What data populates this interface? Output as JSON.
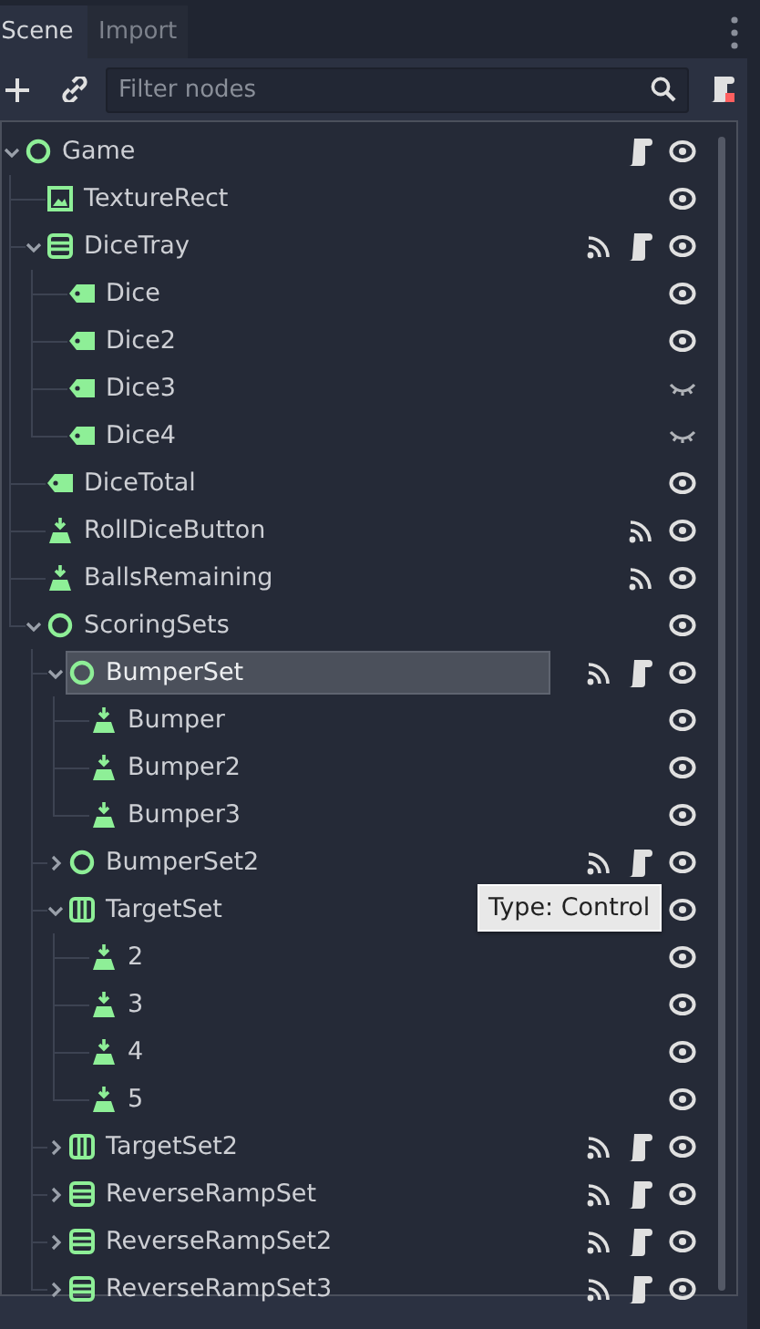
{
  "tabs": [
    {
      "label": "Scene",
      "selected": true
    },
    {
      "label": "Import",
      "selected": false
    }
  ],
  "filter": {
    "placeholder": "Filter nodes"
  },
  "tree": [
    {
      "name": "Game",
      "kind": "control",
      "expanded": true,
      "signals": false,
      "script": true,
      "visible": true,
      "selected": false,
      "children": [
        {
          "name": "TextureRect",
          "kind": "texture_rect",
          "signals": false,
          "script": false,
          "visible": true,
          "selected": false
        },
        {
          "name": "DiceTray",
          "kind": "vbox",
          "expanded": true,
          "signals": true,
          "script": true,
          "visible": true,
          "selected": false,
          "children": [
            {
              "name": "Dice",
              "kind": "label",
              "signals": false,
              "script": false,
              "visible": true,
              "selected": false
            },
            {
              "name": "Dice2",
              "kind": "label",
              "signals": false,
              "script": false,
              "visible": true,
              "selected": false
            },
            {
              "name": "Dice3",
              "kind": "label",
              "signals": false,
              "script": false,
              "visible": false,
              "selected": false
            },
            {
              "name": "Dice4",
              "kind": "label",
              "signals": false,
              "script": false,
              "visible": false,
              "selected": false
            }
          ]
        },
        {
          "name": "DiceTotal",
          "kind": "label",
          "signals": false,
          "script": false,
          "visible": true,
          "selected": false
        },
        {
          "name": "RollDiceButton",
          "kind": "texture_button",
          "signals": true,
          "script": false,
          "visible": true,
          "selected": false
        },
        {
          "name": "BallsRemaining",
          "kind": "texture_button",
          "signals": true,
          "script": false,
          "visible": true,
          "selected": false
        },
        {
          "name": "ScoringSets",
          "kind": "control",
          "expanded": true,
          "signals": false,
          "script": false,
          "visible": true,
          "selected": false,
          "children": [
            {
              "name": "BumperSet",
              "kind": "control",
              "expanded": true,
              "signals": true,
              "script": true,
              "visible": true,
              "selected": true,
              "children": [
                {
                  "name": "Bumper",
                  "kind": "texture_button",
                  "signals": false,
                  "script": false,
                  "visible": true,
                  "selected": false
                },
                {
                  "name": "Bumper2",
                  "kind": "texture_button",
                  "signals": false,
                  "script": false,
                  "visible": true,
                  "selected": false
                },
                {
                  "name": "Bumper3",
                  "kind": "texture_button",
                  "signals": false,
                  "script": false,
                  "visible": true,
                  "selected": false
                }
              ]
            },
            {
              "name": "BumperSet2",
              "kind": "control",
              "expanded": false,
              "signals": true,
              "script": true,
              "visible": true,
              "selected": false
            },
            {
              "name": "TargetSet",
              "kind": "hbox",
              "expanded": true,
              "signals": false,
              "script": false,
              "visible": true,
              "selected": false,
              "children": [
                {
                  "name": "2",
                  "kind": "texture_button",
                  "signals": false,
                  "script": false,
                  "visible": true,
                  "selected": false
                },
                {
                  "name": "3",
                  "kind": "texture_button",
                  "signals": false,
                  "script": false,
                  "visible": true,
                  "selected": false
                },
                {
                  "name": "4",
                  "kind": "texture_button",
                  "signals": false,
                  "script": false,
                  "visible": true,
                  "selected": false
                },
                {
                  "name": "5",
                  "kind": "texture_button",
                  "signals": false,
                  "script": false,
                  "visible": true,
                  "selected": false
                }
              ]
            },
            {
              "name": "TargetSet2",
              "kind": "hbox",
              "expanded": false,
              "signals": true,
              "script": true,
              "visible": true,
              "selected": false
            },
            {
              "name": "ReverseRampSet",
              "kind": "vbox",
              "expanded": false,
              "signals": true,
              "script": true,
              "visible": true,
              "selected": false
            },
            {
              "name": "ReverseRampSet2",
              "kind": "vbox",
              "expanded": false,
              "signals": true,
              "script": true,
              "visible": true,
              "selected": false
            },
            {
              "name": "ReverseRampSet3",
              "kind": "vbox",
              "expanded": false,
              "signals": true,
              "script": true,
              "visible": true,
              "selected": false
            }
          ]
        }
      ]
    }
  ],
  "tooltip": "Type: Control"
}
